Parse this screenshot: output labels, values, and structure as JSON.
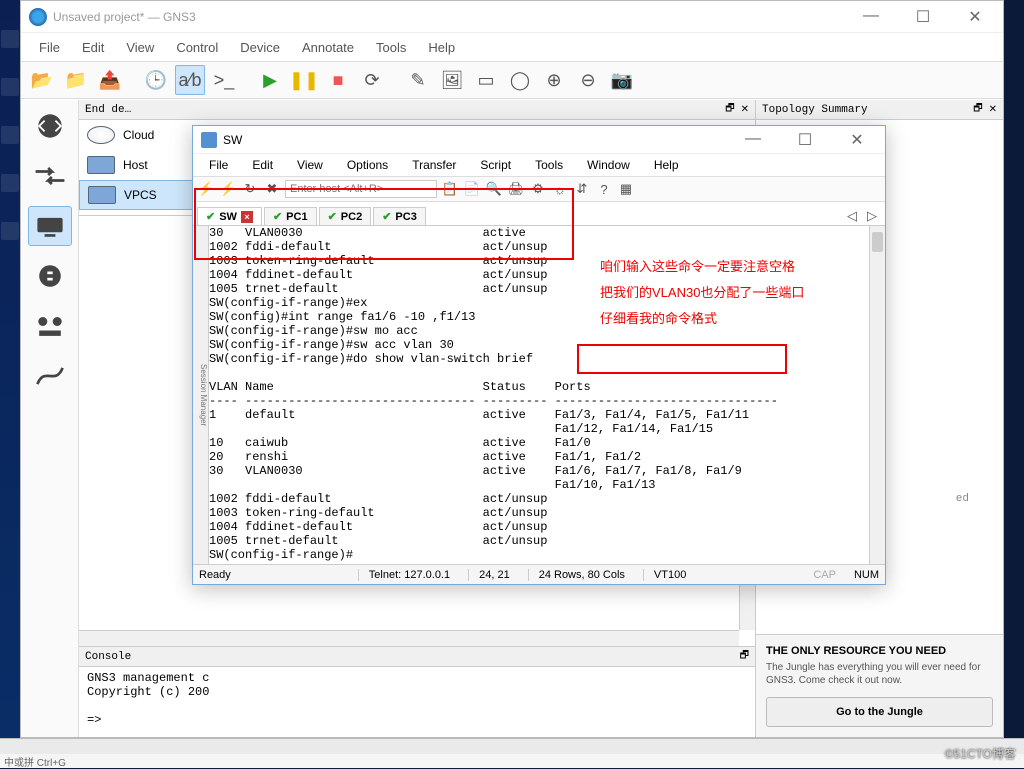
{
  "gns3": {
    "title": "Unsaved project* — GNS3",
    "menus": [
      "File",
      "Edit",
      "View",
      "Control",
      "Device",
      "Annotate",
      "Tools",
      "Help"
    ],
    "devices_panel_title": "End de…",
    "devices": [
      {
        "label": "Cloud",
        "kind": "cloud"
      },
      {
        "label": "Host",
        "kind": "host"
      },
      {
        "label": "VPCS",
        "kind": "vpcs",
        "selected": true
      }
    ],
    "console": {
      "title": "Console",
      "lines": "GNS3 management c\nCopyright (c) 200\n\n=>"
    },
    "topology_title": "Topology Summary",
    "ad": {
      "title": "THE ONLY RESOURCE YOU NEED",
      "text": "The Jungle has everything you will ever need for GNS3. Come check it out now.",
      "button": "Go to the Jungle"
    }
  },
  "crt": {
    "title": "SW",
    "menus": [
      "File",
      "Edit",
      "View",
      "Options",
      "Transfer",
      "Script",
      "Tools",
      "Window",
      "Help"
    ],
    "host_placeholder": "Enter host <Alt+R>",
    "tabs": [
      {
        "label": "SW",
        "active": true,
        "closable": true
      },
      {
        "label": "PC1"
      },
      {
        "label": "PC2"
      },
      {
        "label": "PC3"
      }
    ],
    "terminal": "30   VLAN0030                         active\n1002 fddi-default                     act/unsup\n1003 token-ring-default               act/unsup\n1004 fddinet-default                  act/unsup\n1005 trnet-default                    act/unsup\nSW(config-if-range)#ex\nSW(config)#int range fa1/6 -10 ,f1/13\nSW(config-if-range)#sw mo acc\nSW(config-if-range)#sw acc vlan 30\nSW(config-if-range)#do show vlan-switch brief\n\nVLAN Name                             Status    Ports\n---- -------------------------------- --------- -------------------------------\n1    default                          active    Fa1/3, Fa1/4, Fa1/5, Fa1/11\n                                                Fa1/12, Fa1/14, Fa1/15\n10   caiwub                           active    Fa1/0\n20   renshi                           active    Fa1/1, Fa1/2\n30   VLAN0030                         active    Fa1/6, Fa1/7, Fa1/8, Fa1/9\n                                                Fa1/10, Fa1/13\n1002 fddi-default                     act/unsup\n1003 token-ring-default               act/unsup\n1004 fddinet-default                  act/unsup\n1005 trnet-default                    act/unsup\nSW(config-if-range)#",
    "status": {
      "ready": "Ready",
      "conn": "Telnet: 127.0.0.1",
      "pos": "24,  21",
      "size": "24 Rows, 80 Cols",
      "term": "VT100",
      "cap": "CAP",
      "num": "NUM"
    }
  },
  "annotations": {
    "line1": "咱们输入这些命令一定要注意空格",
    "line2": "把我们的VLAN30也分配了一些端口",
    "line3": "仔细看我的命令格式"
  },
  "watermark": "©51CTO博客",
  "bottom_status": "中或拼 Ctrl+G"
}
